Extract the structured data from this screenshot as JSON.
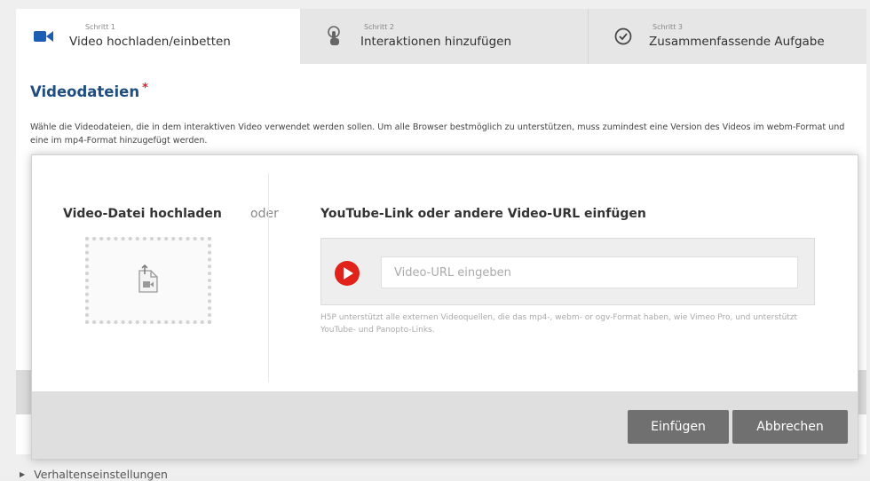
{
  "tabs": [
    {
      "step": "Schritt 1",
      "label": "Video hochladen/einbetten",
      "icon": "video-camera-icon",
      "active": true
    },
    {
      "step": "Schritt 2",
      "label": "Interaktionen hinzufügen",
      "icon": "touch-hand-icon",
      "active": false
    },
    {
      "step": "Schritt 3",
      "label": "Zusammenfassende Aufgabe",
      "icon": "check-circle-icon",
      "active": false
    }
  ],
  "field": {
    "title": "Videodateien",
    "required_mark": "*",
    "description": "Wähle die Videodateien, die in dem interaktiven Video verwendet werden sollen. Um alle Browser bestmöglich zu unterstützen, muss zumindest eine Version des Videos im webm-Format und eine im mp4-Format hinzugefügt werden."
  },
  "dialog": {
    "upload_title": "Video-Datei hochladen",
    "or_text": "oder",
    "url_title": "YouTube-Link oder andere Video-URL einfügen",
    "url_placeholder": "Video-URL eingeben",
    "url_value": "",
    "help_text": "H5P unterstützt alle externen Videoquellen, die das mp4-, webm- or ogv-Format haben, wie Vimeo Pro, und unterstützt YouTube- und Panopto-Links.",
    "insert_label": "Einfügen",
    "cancel_label": "Abbrechen"
  },
  "below": {
    "behaviour_label": "Verhaltenseinstellungen"
  },
  "colors": {
    "accent_blue": "#1f4e82",
    "required_red": "#d52323",
    "youtube_red": "#e1221b",
    "button_grey": "#707070",
    "tab_icon_blue": "#1a5fb4"
  }
}
